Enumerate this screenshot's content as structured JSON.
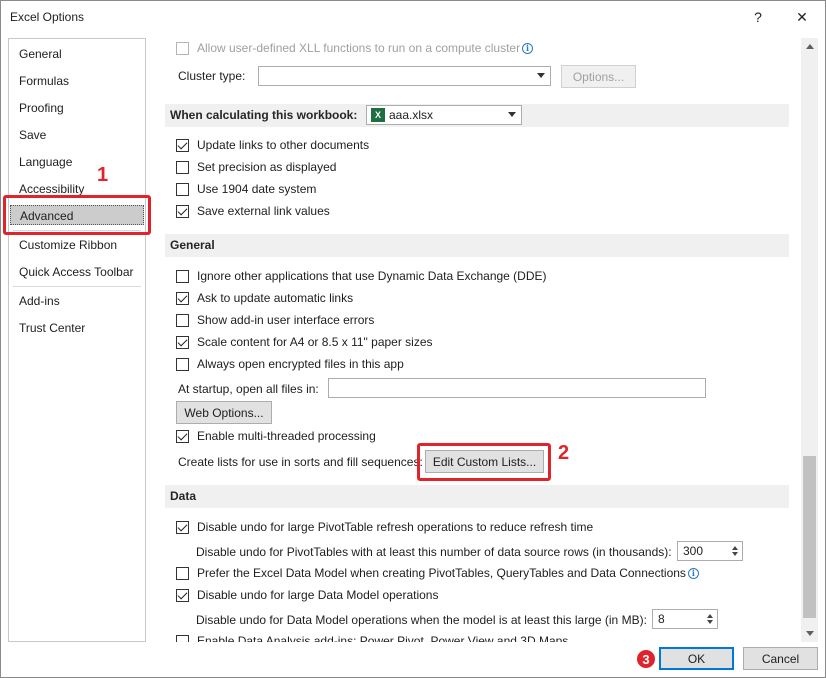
{
  "window": {
    "title": "Excel Options",
    "help_glyph": "?",
    "close_glyph": "✕"
  },
  "nav": {
    "items": [
      {
        "label": "General"
      },
      {
        "label": "Formulas"
      },
      {
        "label": "Proofing"
      },
      {
        "label": "Save"
      },
      {
        "label": "Language"
      },
      {
        "label": "Accessibility"
      },
      {
        "label": "Advanced",
        "selected": true
      },
      {
        "label": "Customize Ribbon"
      },
      {
        "label": "Quick Access Toolbar"
      },
      {
        "label": "Add-ins"
      },
      {
        "label": "Trust Center"
      }
    ]
  },
  "formulas": {
    "xll_label": "Allow user-defined XLL functions to run on a compute cluster",
    "cluster_type_label": "Cluster type:",
    "cluster_type_value": "",
    "options_button": "Options..."
  },
  "workbook_calc": {
    "header": "When calculating this workbook:",
    "workbook_value": "aaa.xlsx",
    "update_links": "Update links to other documents",
    "set_precision": "Set precision as displayed",
    "use_1904": "Use 1904 date system",
    "save_external": "Save external link values"
  },
  "general": {
    "header": "General",
    "ignore_dde": "Ignore other applications that use Dynamic Data Exchange (DDE)",
    "ask_update": "Ask to update automatic links",
    "show_addin_errors": "Show add-in user interface errors",
    "scale_content": "Scale content for A4 or 8.5 x 11\" paper sizes",
    "open_encrypted": "Always open encrypted files in this app",
    "startup_label": "At startup, open all files in:",
    "startup_value": "",
    "web_options_button": "Web Options...",
    "multithreaded": "Enable multi-threaded processing",
    "custom_lists_label": "Create lists for use in sorts and fill sequences:",
    "edit_custom_lists_button": "Edit Custom Lists..."
  },
  "data": {
    "header": "Data",
    "disable_undo_pivot": "Disable undo for large PivotTable refresh operations to reduce refresh time",
    "pivot_rows_label": "Disable undo for PivotTables with at least this number of data source rows (in thousands):",
    "pivot_rows_value": "300",
    "prefer_data_model": "Prefer the Excel Data Model when creating PivotTables, QueryTables and Data Connections",
    "disable_undo_model": "Disable undo for large Data Model operations",
    "model_size_label": "Disable undo for Data Model operations when the model is at least this large (in MB):",
    "model_size_value": "8",
    "enable_addins": "Enable Data Analysis add-ins: Power Pivot, Power View and 3D Maps"
  },
  "footer": {
    "ok": "OK",
    "cancel": "Cancel"
  },
  "annotations": {
    "marker1": "1",
    "marker2": "2",
    "marker3": "3"
  },
  "colors": {
    "highlight": "#e0242c",
    "selection": "#cccccc",
    "default_button_border": "#0078d7"
  },
  "checked": {
    "xll": false,
    "update_links": true,
    "set_precision": false,
    "use_1904": false,
    "save_external": true,
    "ignore_dde": false,
    "ask_update": true,
    "show_addin_errors": false,
    "scale_content": true,
    "open_encrypted": false,
    "multithreaded": true,
    "disable_undo_pivot": true,
    "prefer_data_model": false,
    "disable_undo_model": true,
    "enable_addins": false
  }
}
